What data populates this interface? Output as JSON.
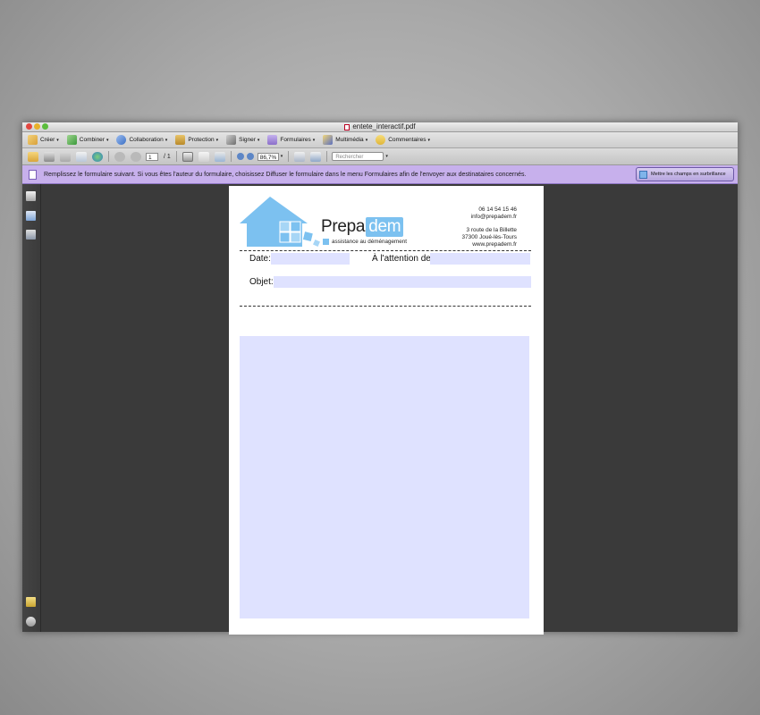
{
  "window": {
    "title": "entete_interactif.pdf"
  },
  "menu": [
    {
      "label": "Créer",
      "icon": "create-icon",
      "color": "#d8a13a"
    },
    {
      "label": "Combiner",
      "icon": "combine-icon",
      "color": "#3b9a3b"
    },
    {
      "label": "Collaboration",
      "icon": "collaboration-icon",
      "color": "#3b6fc4"
    },
    {
      "label": "Protection",
      "icon": "lock-icon",
      "color": "#c99a3a"
    },
    {
      "label": "Signer",
      "icon": "pen-icon",
      "color": "#777777"
    },
    {
      "label": "Formulaires",
      "icon": "forms-icon",
      "color": "#8b6fc9"
    },
    {
      "label": "Multimédia",
      "icon": "multimedia-icon",
      "color": "#c9a63a"
    },
    {
      "label": "Commentaires",
      "icon": "comment-icon",
      "color": "#e0b63a"
    }
  ],
  "toolbar": {
    "page_current": "1",
    "page_total": "/ 1",
    "zoom": "86,7%",
    "search_placeholder": "Rechercher"
  },
  "notice": {
    "text": "Remplissez le formulaire suivant. Si vous êtes l'auteur du formulaire, choisissez Diffuser le formulaire dans le menu Formulaires afin de l'envoyer aux destinataires concernés.",
    "highlight_button": "Mettre les champs en surbrillance"
  },
  "letterhead": {
    "brand_main": "Prepa",
    "brand_highlight": "dem",
    "tagline": "assistance au  déménagement",
    "phone": "06 14 54 15 46",
    "email": "info@prepadem.fr",
    "address1": "3 route de la Billette",
    "address2": "37300 Joué-lès-Tours",
    "website": "www.prepadem.fr",
    "brand_color": "#7cc1f0"
  },
  "form": {
    "date_label": "Date:",
    "attention_label": "À l'attention de:",
    "object_label": "Objet:",
    "field_color": "#dfe2ff"
  }
}
